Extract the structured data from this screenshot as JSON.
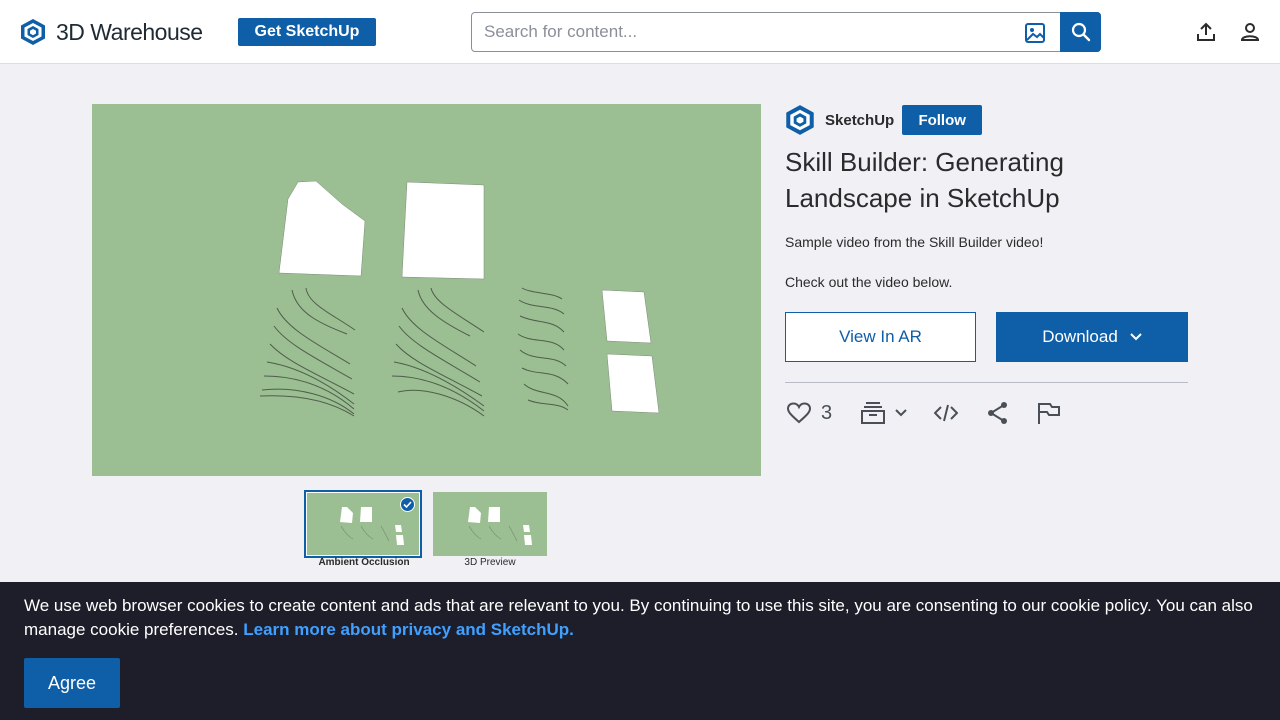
{
  "header": {
    "logo_text": "3D Warehouse",
    "get_sketchup_label": "Get SketchUp",
    "search_placeholder": "Search for content..."
  },
  "viewer": {
    "thumbnails": [
      {
        "label": "Ambient Occlusion",
        "selected": true
      },
      {
        "label": "3D Preview",
        "selected": false
      }
    ]
  },
  "model": {
    "author": "SketchUp",
    "follow_label": "Follow",
    "title": "Skill Builder: Generating Landscape in SketchUp",
    "description_1": "Sample video from the Skill Builder video!",
    "description_2": "Check out the video below.",
    "view_ar_label": "View In AR",
    "download_label": "Download",
    "likes": "3"
  },
  "cookie": {
    "text": "We use web browser cookies to create content and ads that are relevant to you. By continuing to use this site, you are consenting to our cookie policy. You can also manage cookie preferences. ",
    "link_text": "Learn more about privacy and SketchUp.",
    "agree_label": "Agree"
  },
  "colors": {
    "brand_blue": "#0f5ea8",
    "image_bg": "#9bbf92",
    "banner_bg": "#1e1e2b",
    "link": "#3fa0ff"
  }
}
